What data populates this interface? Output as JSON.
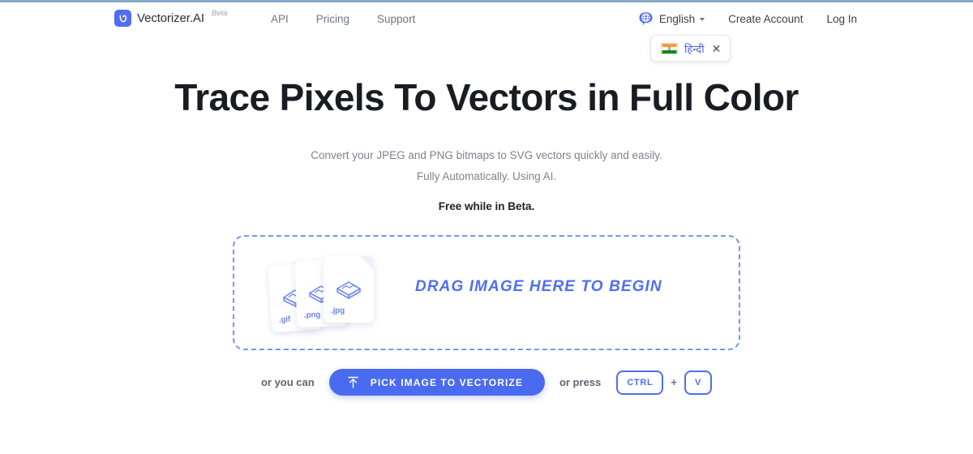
{
  "brand": {
    "name": "Vectorizer.AI",
    "beta_tag": "Beta",
    "logo_icon": "vectorizer-v-logo"
  },
  "nav": {
    "items": [
      {
        "label": "API"
      },
      {
        "label": "Pricing"
      },
      {
        "label": "Support"
      }
    ]
  },
  "account": {
    "language": {
      "icon": "globe-icon",
      "label": "English",
      "caret_icon": "chevron-down-icon"
    },
    "create_account_label": "Create Account",
    "log_in_label": "Log In"
  },
  "language_popup": {
    "flag_icon": "india-flag-icon",
    "label": "हिन्दी",
    "close_icon": "close-icon",
    "close_glyph": "✕"
  },
  "hero": {
    "title": "Trace Pixels To Vectors in Full Color",
    "subtitle_line1": "Convert your JPEG and PNG bitmaps to SVG vectors quickly and easily.",
    "subtitle_line2": "Fully Automatically. Using AI.",
    "free_note": "Free while in Beta."
  },
  "dropzone": {
    "prompt": "DRAG IMAGE HERE TO BEGIN",
    "files": [
      {
        "ext": ".gif",
        "icon": "image-file-icon"
      },
      {
        "ext": ".png",
        "icon": "image-file-icon"
      },
      {
        "ext": ".jpg",
        "icon": "image-file-icon"
      }
    ]
  },
  "actions": {
    "or_you_can": "or you can",
    "pick_button_label": "PICK IMAGE TO VECTORIZE",
    "pick_button_icon": "upload-arrow-icon",
    "or_press": "or press",
    "keys": [
      {
        "label": "CTRL"
      },
      {
        "label": "V"
      }
    ],
    "key_separator": "+"
  },
  "colors": {
    "accent_blue": "#4e6ef2",
    "button_blue": "#4a6bf0",
    "dash_blue": "#7b93f5",
    "text_dark": "#191c22",
    "text_muted": "#7b828f",
    "top_rule": "#8aa8c8"
  }
}
